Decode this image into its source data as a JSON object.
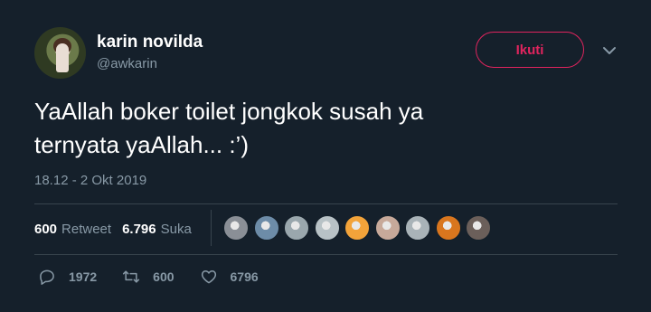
{
  "user": {
    "display_name": "karin novilda",
    "handle": "@awkarin",
    "avatar_icon": "profile-photo"
  },
  "follow_button": {
    "label": "Ikuti",
    "color": "#e0245e"
  },
  "tweet": {
    "line1": "YaAllah boker toilet jongkok susah ya",
    "line2": "ternyata yaAllah... :’)",
    "timestamp": "18.12 - 2 Okt 2019"
  },
  "stats": {
    "retweets_count": "600",
    "retweets_label": "Retweet",
    "likes_count": "6.796",
    "likes_label": "Suka"
  },
  "likers": [
    {
      "icon": "liker-avatar-1",
      "color": "#8a8f96"
    },
    {
      "icon": "liker-avatar-2",
      "color": "#6d8ca8"
    },
    {
      "icon": "liker-avatar-3",
      "color": "#9aa7ad"
    },
    {
      "icon": "liker-avatar-4",
      "color": "#b8c2c6"
    },
    {
      "icon": "emoji-avatar",
      "color": "#f2a33a"
    },
    {
      "icon": "liker-avatar-6",
      "color": "#c7a99a"
    },
    {
      "icon": "liker-avatar-7",
      "color": "#a9b3b8"
    },
    {
      "icon": "star-avatar",
      "color": "#d9761e"
    },
    {
      "icon": "liker-avatar-9",
      "color": "#6b5f5a"
    }
  ],
  "actions": {
    "reply_count": "1972",
    "retweet_count": "600",
    "like_count": "6796"
  },
  "colors": {
    "background": "#15202b",
    "secondary_text": "#8899a6",
    "divider": "#38444d"
  }
}
